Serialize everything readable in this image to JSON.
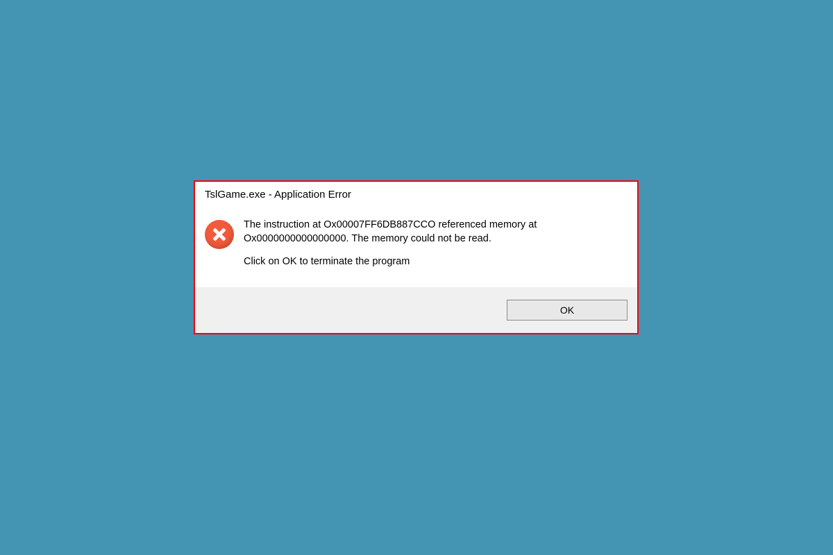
{
  "dialog": {
    "title": "TslGame.exe - Application Error",
    "message_line1": "The instruction at Ox00007FF6DB887CCO referenced memory at Ox0000000000000000. The memory could not be read.",
    "message_line2": "Click on OK to terminate the program",
    "ok_label": "OK"
  }
}
